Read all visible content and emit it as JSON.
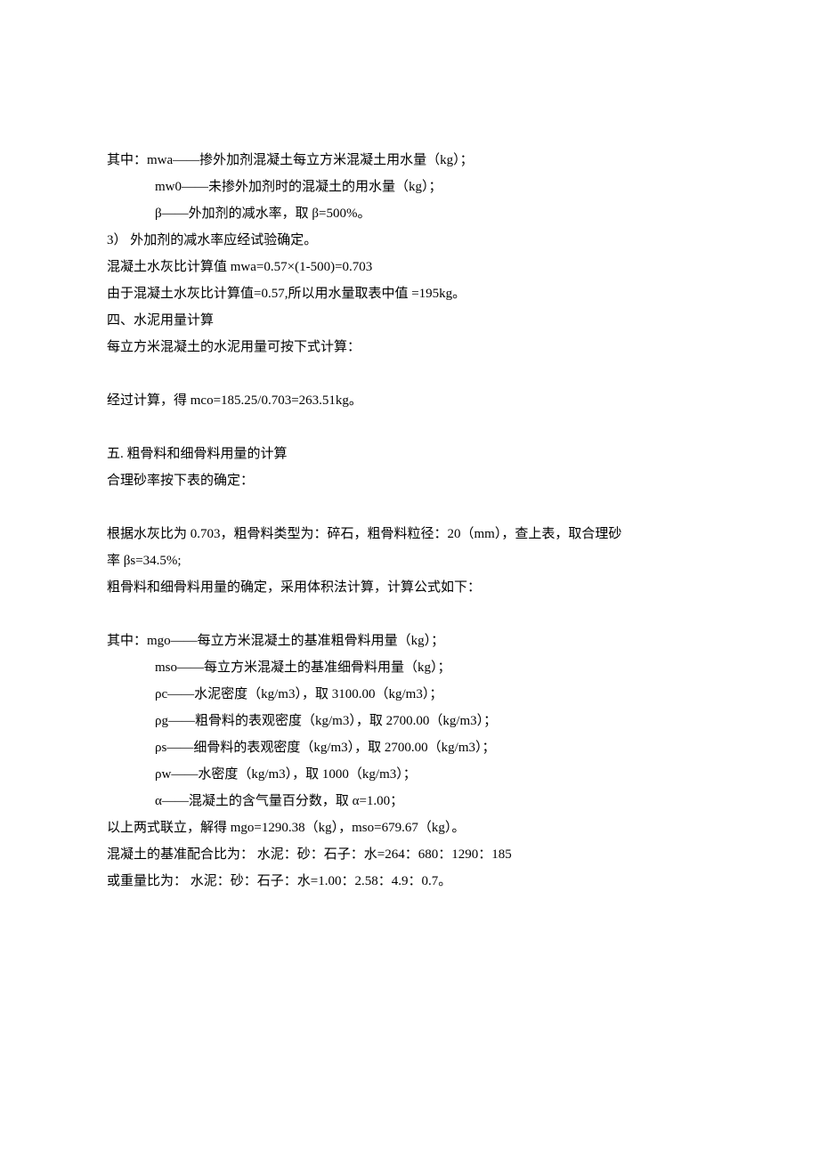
{
  "lines": {
    "l1": "其中：mwa——掺外加剂混凝土每立方米混凝土用水量（kg）；",
    "l2": "mw0——未掺外加剂时的混凝土的用水量（kg）；",
    "l3": "β——外加剂的减水率，取 β=500%。",
    "l4": "3）  外加剂的减水率应经试验确定。",
    "l5": "混凝土水灰比计算值 mwa=0.57×(1-500)=0.703",
    "l6": "由于混凝土水灰比计算值=0.57,所以用水量取表中值  =195kg。",
    "l7": "四、水泥用量计算",
    "l8": "每立方米混凝土的水泥用量可按下式计算：",
    "l9": "经过计算，得  mco=185.25/0.703=263.51kg。",
    "l10": "五.  粗骨料和细骨料用量的计算",
    "l11": "合理砂率按下表的确定：",
    "l12": "根据水灰比为 0.703，粗骨料类型为：碎石，粗骨料粒径：20（mm），查上表，取合理砂",
    "l13": "率 βs=34.5%;",
    "l14": "粗骨料和细骨料用量的确定，采用体积法计算，计算公式如下：",
    "l15": "其中：mgo——每立方米混凝土的基准粗骨料用量（kg）；",
    "l16": "mso——每立方米混凝土的基准细骨料用量（kg）；",
    "l17": "ρc——水泥密度（kg/m3），取 3100.00（kg/m3）；",
    "l18": "ρg——粗骨料的表观密度（kg/m3），取 2700.00（kg/m3）；",
    "l19": "ρs——细骨料的表观密度（kg/m3），取 2700.00（kg/m3）；",
    "l20": "ρw——水密度（kg/m3），取 1000（kg/m3）；",
    "l21": "α——混凝土的含气量百分数，取 α=1.00；",
    "l22": "以上两式联立，解得  mgo=1290.38（kg），mso=679.67（kg）。",
    "l23": "混凝土的基准配合比为：  水泥：砂：石子：水=264：680：1290：185",
    "l24": "或重量比为：  水泥：砂：石子：水=1.00：2.58：4.9：0.7。"
  }
}
